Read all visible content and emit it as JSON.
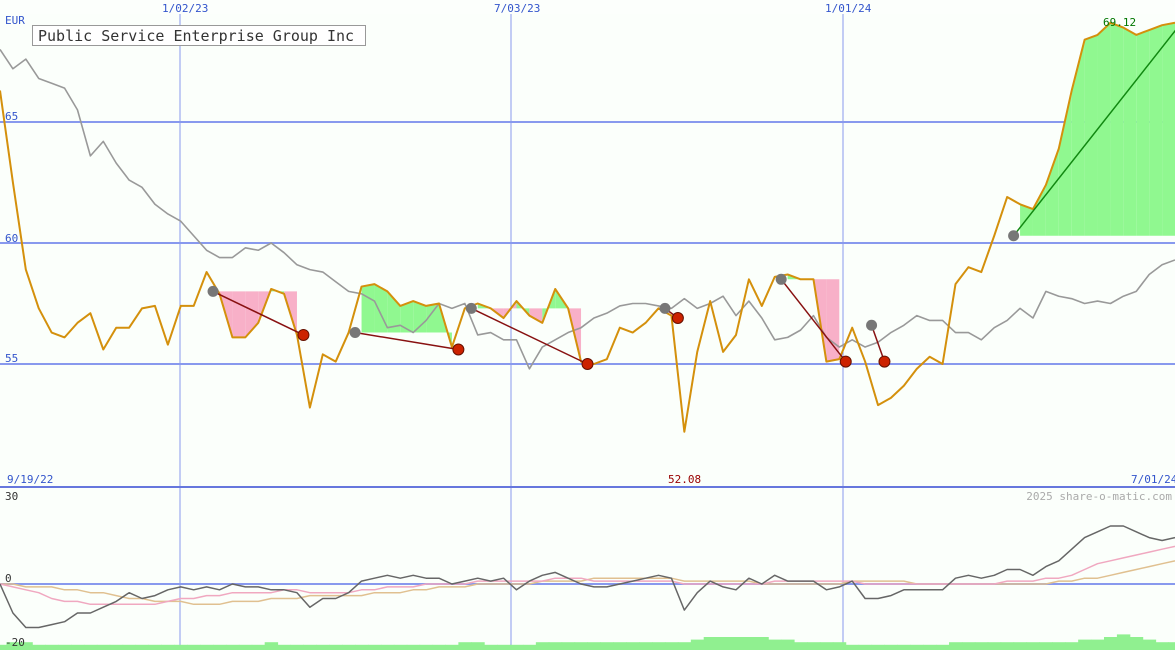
{
  "chart_data": [
    {
      "type": "line",
      "title": "Public Service Enterprise Group Inc",
      "currency_label": "EUR",
      "ylim": [
        50,
        70
      ],
      "y_ticks": [
        55,
        60,
        65
      ],
      "grid": true,
      "x_top_labels": [
        "1/02/23",
        "7/03/23",
        "1/01/24"
      ],
      "x_start_label": "9/19/22",
      "x_end_label": "7/01/24",
      "min_label": "52.08",
      "max_label": "69.12",
      "watermark": "2025 share-o-matic.com",
      "series": [
        {
          "role": "price",
          "color": "#d4900c",
          "x": [
            0,
            1,
            2,
            3,
            4,
            5,
            6,
            7,
            8,
            9,
            10,
            11,
            12,
            13,
            14,
            15,
            16,
            17,
            18,
            19,
            20,
            21,
            22,
            23,
            24,
            25,
            26,
            27,
            28,
            29,
            30,
            31,
            32,
            33,
            34,
            35,
            36,
            37,
            38,
            39,
            40,
            41,
            42,
            43,
            44,
            45,
            46,
            47,
            48,
            49,
            50,
            51,
            52,
            53,
            54,
            55,
            56,
            57,
            58,
            59,
            60,
            61,
            62,
            63,
            64,
            65,
            66,
            67,
            68,
            69,
            70,
            71,
            72,
            73,
            74,
            75,
            76,
            77,
            78,
            79,
            80,
            81,
            82,
            83,
            84,
            85,
            86,
            87,
            88,
            89,
            90,
            91
          ],
          "y": [
            66.3,
            62.5,
            58.9,
            57.3,
            56.3,
            56.1,
            56.7,
            57.1,
            55.6,
            56.5,
            56.5,
            57.3,
            57.4,
            55.8,
            57.4,
            57.4,
            58.8,
            57.9,
            56.1,
            56.1,
            56.7,
            58.1,
            57.9,
            56.2,
            53.2,
            55.4,
            55.1,
            56.3,
            58.2,
            58.3,
            58.0,
            57.4,
            57.6,
            57.4,
            57.5,
            55.7,
            57.3,
            57.5,
            57.3,
            56.9,
            57.6,
            57.0,
            56.7,
            58.1,
            57.3,
            55.1,
            55.0,
            55.2,
            56.5,
            56.3,
            56.7,
            57.3,
            57.0,
            52.2,
            55.5,
            57.6,
            55.5,
            56.2,
            58.5,
            57.4,
            58.6,
            58.7,
            58.5,
            58.5,
            55.1,
            55.2,
            56.5,
            55.1,
            53.3,
            53.6,
            54.1,
            54.8,
            55.3,
            55.0,
            58.3,
            59.0,
            58.8,
            60.3,
            61.9,
            61.6,
            61.4,
            62.4,
            63.9,
            66.3,
            68.4,
            68.6,
            69.1,
            68.9,
            68.6,
            68.8,
            69.0,
            69.1
          ]
        },
        {
          "role": "moving_average",
          "color": "#999999",
          "x": [
            0,
            1,
            2,
            3,
            4,
            5,
            6,
            7,
            8,
            9,
            10,
            11,
            12,
            13,
            14,
            15,
            16,
            17,
            18,
            19,
            20,
            21,
            22,
            23,
            24,
            25,
            26,
            27,
            28,
            29,
            30,
            31,
            32,
            33,
            34,
            35,
            36,
            37,
            38,
            39,
            40,
            41,
            42,
            43,
            44,
            45,
            46,
            47,
            48,
            49,
            50,
            51,
            52,
            53,
            54,
            55,
            56,
            57,
            58,
            59,
            60,
            61,
            62,
            63,
            64,
            65,
            66,
            67,
            68,
            69,
            70,
            71,
            72,
            73,
            74,
            75,
            76,
            77,
            78,
            79,
            80,
            81,
            82,
            83,
            84,
            85,
            86,
            87,
            88,
            89,
            90,
            91
          ],
          "y": [
            68.0,
            67.2,
            67.6,
            66.8,
            66.6,
            66.4,
            65.5,
            63.6,
            64.2,
            63.3,
            62.6,
            62.3,
            61.6,
            61.2,
            60.9,
            60.3,
            59.7,
            59.4,
            59.4,
            59.8,
            59.7,
            60.0,
            59.6,
            59.1,
            58.9,
            58.8,
            58.4,
            58.0,
            57.9,
            57.6,
            56.5,
            56.6,
            56.3,
            56.8,
            57.5,
            57.3,
            57.5,
            56.2,
            56.3,
            56.0,
            56.0,
            54.8,
            55.7,
            56.0,
            56.3,
            56.5,
            56.9,
            57.1,
            57.4,
            57.5,
            57.5,
            57.4,
            57.3,
            57.7,
            57.3,
            57.5,
            57.8,
            57.0,
            57.6,
            56.9,
            56.0,
            56.1,
            56.4,
            57.0,
            56.1,
            55.7,
            56.0,
            55.7,
            55.9,
            56.3,
            56.6,
            57.0,
            56.8,
            56.8,
            56.3,
            56.3,
            56.0,
            56.5,
            56.8,
            57.3,
            56.9,
            58.0,
            57.8,
            57.7,
            57.5,
            57.6,
            57.5,
            57.8,
            58.0,
            58.7,
            59.1,
            59.3
          ]
        }
      ],
      "signals": [
        {
          "x0": 16.5,
          "y0": 58.0,
          "x1": 23.5,
          "y1": 56.2,
          "type": "down"
        },
        {
          "x0": 27.5,
          "y0": 56.3,
          "x1": 35.5,
          "y1": 55.6,
          "type": "down"
        },
        {
          "x0": 36.5,
          "y0": 57.3,
          "x1": 45.5,
          "y1": 55.0,
          "type": "down"
        },
        {
          "x0": 51.5,
          "y0": 57.3,
          "x1": 52.5,
          "y1": 56.9,
          "type": "down"
        },
        {
          "x0": 60.5,
          "y0": 58.5,
          "x1": 65.5,
          "y1": 55.1,
          "type": "down"
        },
        {
          "x0": 67.5,
          "y0": 56.6,
          "x1": 68.5,
          "y1": 55.1,
          "type": "down"
        },
        {
          "x0": 78.5,
          "y0": 60.3,
          "x1": 91.5,
          "y1": 69.1,
          "type": "up"
        }
      ]
    },
    {
      "type": "line",
      "role": "oscillator",
      "ylim": [
        -20,
        30
      ],
      "y_ticks": [
        -20,
        0,
        30
      ],
      "series": [
        {
          "color": "#666666",
          "x": [
            0,
            1,
            2,
            3,
            4,
            5,
            6,
            7,
            8,
            9,
            10,
            11,
            12,
            13,
            14,
            15,
            16,
            17,
            18,
            19,
            20,
            21,
            22,
            23,
            24,
            25,
            26,
            27,
            28,
            29,
            30,
            31,
            32,
            33,
            34,
            35,
            36,
            37,
            38,
            39,
            40,
            41,
            42,
            43,
            44,
            45,
            46,
            47,
            48,
            49,
            50,
            51,
            52,
            53,
            54,
            55,
            56,
            57,
            58,
            59,
            60,
            61,
            62,
            63,
            64,
            65,
            66,
            67,
            68,
            69,
            70,
            71,
            72,
            73,
            74,
            75,
            76,
            77,
            78,
            79,
            80,
            81,
            82,
            83,
            84,
            85,
            86,
            87,
            88,
            89,
            90,
            91
          ],
          "y": [
            0,
            -10,
            -15,
            -15,
            -14,
            -13,
            -10,
            -10,
            -8,
            -6,
            -3,
            -5,
            -4,
            -2,
            -1,
            -2,
            -1,
            -2,
            0,
            -1,
            -1,
            -2,
            -2,
            -3,
            -8,
            -5,
            -5,
            -3,
            1,
            2,
            3,
            2,
            3,
            2,
            2,
            0,
            1,
            2,
            1,
            2,
            -2,
            1,
            3,
            4,
            2,
            0,
            -1,
            -1,
            0,
            1,
            2,
            3,
            2,
            -9,
            -3,
            1,
            -1,
            -2,
            2,
            0,
            3,
            1,
            1,
            1,
            -2,
            -1,
            1,
            -5,
            -5,
            -4,
            -2,
            -2,
            -2,
            -2,
            2,
            3,
            2,
            3,
            5,
            5,
            3,
            6,
            8,
            12,
            16,
            18,
            20,
            20,
            18,
            16,
            15,
            16
          ]
        },
        {
          "color": "#f0a8c0",
          "x": [
            0,
            1,
            2,
            3,
            4,
            5,
            6,
            7,
            8,
            9,
            10,
            11,
            12,
            13,
            14,
            15,
            16,
            17,
            18,
            19,
            20,
            21,
            22,
            23,
            24,
            25,
            26,
            27,
            28,
            29,
            30,
            31,
            32,
            33,
            34,
            35,
            36,
            37,
            38,
            39,
            40,
            41,
            42,
            43,
            44,
            45,
            46,
            47,
            48,
            49,
            50,
            51,
            52,
            53,
            54,
            55,
            56,
            57,
            58,
            59,
            60,
            61,
            62,
            63,
            64,
            65,
            66,
            67,
            68,
            69,
            70,
            71,
            72,
            73,
            74,
            75,
            76,
            77,
            78,
            79,
            80,
            81,
            82,
            83,
            84,
            85,
            86,
            87,
            88,
            89,
            90,
            91
          ],
          "y": [
            0,
            -1,
            -2,
            -3,
            -5,
            -6,
            -6,
            -7,
            -7,
            -7,
            -7,
            -7,
            -7,
            -6,
            -5,
            -5,
            -4,
            -4,
            -3,
            -3,
            -3,
            -3,
            -2,
            -2,
            -3,
            -3,
            -3,
            -3,
            -2,
            -2,
            -1,
            -1,
            -1,
            0,
            0,
            0,
            0,
            1,
            1,
            1,
            1,
            1,
            1,
            2,
            2,
            2,
            1,
            1,
            1,
            1,
            1,
            1,
            1,
            0,
            0,
            0,
            0,
            0,
            0,
            0,
            1,
            1,
            1,
            1,
            1,
            1,
            1,
            0,
            0,
            0,
            0,
            0,
            0,
            0,
            0,
            0,
            0,
            0,
            1,
            1,
            1,
            2,
            2,
            3,
            5,
            7,
            8,
            9,
            10,
            11,
            12,
            13
          ]
        },
        {
          "color": "#e0c090",
          "x": [
            0,
            1,
            2,
            3,
            4,
            5,
            6,
            7,
            8,
            9,
            10,
            11,
            12,
            13,
            14,
            15,
            16,
            17,
            18,
            19,
            20,
            21,
            22,
            23,
            24,
            25,
            26,
            27,
            28,
            29,
            30,
            31,
            32,
            33,
            34,
            35,
            36,
            37,
            38,
            39,
            40,
            41,
            42,
            43,
            44,
            45,
            46,
            47,
            48,
            49,
            50,
            51,
            52,
            53,
            54,
            55,
            56,
            57,
            58,
            59,
            60,
            61,
            62,
            63,
            64,
            65,
            66,
            67,
            68,
            69,
            70,
            71,
            72,
            73,
            74,
            75,
            76,
            77,
            78,
            79,
            80,
            81,
            82,
            83,
            84,
            85,
            86,
            87,
            88,
            89,
            90,
            91
          ],
          "y": [
            0,
            0,
            -1,
            -1,
            -1,
            -2,
            -2,
            -3,
            -3,
            -4,
            -5,
            -5,
            -6,
            -6,
            -6,
            -7,
            -7,
            -7,
            -6,
            -6,
            -6,
            -5,
            -5,
            -5,
            -4,
            -4,
            -4,
            -4,
            -4,
            -3,
            -3,
            -3,
            -2,
            -2,
            -1,
            -1,
            -1,
            0,
            0,
            0,
            0,
            0,
            1,
            1,
            1,
            1,
            2,
            2,
            2,
            2,
            2,
            2,
            2,
            1,
            1,
            1,
            1,
            1,
            1,
            0,
            0,
            0,
            0,
            0,
            0,
            0,
            1,
            1,
            1,
            1,
            1,
            0,
            0,
            0,
            0,
            0,
            0,
            0,
            0,
            0,
            0,
            0,
            1,
            1,
            2,
            2,
            3,
            4,
            5,
            6,
            7,
            8
          ]
        }
      ],
      "volume_bars": [
        2,
        3,
        3,
        2,
        2,
        2,
        2,
        2,
        2,
        2,
        2,
        2,
        2,
        2,
        2,
        2,
        2,
        2,
        2,
        2,
        2,
        3,
        2,
        2,
        2,
        2,
        2,
        2,
        2,
        2,
        2,
        2,
        2,
        2,
        2,
        2,
        3,
        3,
        2,
        2,
        2,
        2,
        3,
        3,
        3,
        3,
        3,
        3,
        3,
        3,
        3,
        3,
        3,
        3,
        4,
        5,
        5,
        5,
        5,
        5,
        4,
        4,
        3,
        3,
        3,
        3,
        2,
        2,
        2,
        2,
        2,
        2,
        2,
        2,
        3,
        3,
        3,
        3,
        3,
        3,
        3,
        3,
        3,
        3,
        4,
        4,
        5,
        6,
        5,
        4,
        3,
        3
      ]
    }
  ]
}
